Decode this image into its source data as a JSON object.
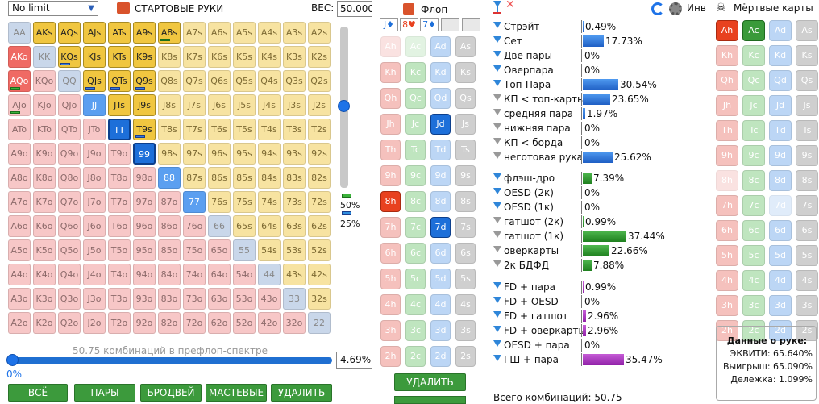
{
  "top": {
    "limit": "No limit",
    "hands_title": "СТАРТОВЫЕ РУКИ",
    "wes_label": "ВЕС:",
    "wes_value": "50.000"
  },
  "matrix": [
    [
      [
        "AA",
        "pp"
      ],
      [
        "AKs",
        "sel-y"
      ],
      [
        "AQs",
        "sel-y"
      ],
      [
        "AJs",
        "sel-y"
      ],
      [
        "ATs",
        "sel-y"
      ],
      [
        "A9s",
        "sel-y"
      ],
      [
        "A8s",
        "sel-y"
      ],
      [
        "A7s",
        "so"
      ],
      [
        "A6s",
        "so"
      ],
      [
        "A5s",
        "so"
      ],
      [
        "A4s",
        "so"
      ],
      [
        "A3s",
        "so"
      ],
      [
        "A2s",
        "so"
      ]
    ],
    [
      [
        "AKo",
        "sel-r"
      ],
      [
        "KK",
        "pp"
      ],
      [
        "KQs",
        "sel-y"
      ],
      [
        "KJs",
        "sel-y"
      ],
      [
        "KTs",
        "sel-y"
      ],
      [
        "K9s",
        "sel-y"
      ],
      [
        "K8s",
        "so"
      ],
      [
        "K7s",
        "so"
      ],
      [
        "K6s",
        "so"
      ],
      [
        "K5s",
        "so"
      ],
      [
        "K4s",
        "so"
      ],
      [
        "K3s",
        "so"
      ],
      [
        "K2s",
        "so"
      ]
    ],
    [
      [
        "AQo",
        "sel-r"
      ],
      [
        "KQo",
        "of"
      ],
      [
        "QQ",
        "pp"
      ],
      [
        "QJs",
        "sel-y"
      ],
      [
        "QTs",
        "sel-y"
      ],
      [
        "Q9s",
        "sel-y"
      ],
      [
        "Q8s",
        "so"
      ],
      [
        "Q7s",
        "so"
      ],
      [
        "Q6s",
        "so"
      ],
      [
        "Q5s",
        "so"
      ],
      [
        "Q4s",
        "so"
      ],
      [
        "Q3s",
        "so"
      ],
      [
        "Q2s",
        "so"
      ]
    ],
    [
      [
        "AJo",
        "of"
      ],
      [
        "KJo",
        "of"
      ],
      [
        "QJo",
        "of"
      ],
      [
        "JJ",
        "sel-b"
      ],
      [
        "JTs",
        "sel-y"
      ],
      [
        "J9s",
        "sel-y"
      ],
      [
        "J8s",
        "so"
      ],
      [
        "J7s",
        "so"
      ],
      [
        "J6s",
        "so"
      ],
      [
        "J5s",
        "so"
      ],
      [
        "J4s",
        "so"
      ],
      [
        "J3s",
        "so"
      ],
      [
        "J2s",
        "so"
      ]
    ],
    [
      [
        "ATo",
        "of"
      ],
      [
        "KTo",
        "of"
      ],
      [
        "QTo",
        "of"
      ],
      [
        "JTo",
        "of"
      ],
      [
        "TT",
        "sel-db"
      ],
      [
        "T9s",
        "sel-y"
      ],
      [
        "T8s",
        "so"
      ],
      [
        "T7s",
        "so"
      ],
      [
        "T6s",
        "so"
      ],
      [
        "T5s",
        "so"
      ],
      [
        "T4s",
        "so"
      ],
      [
        "T3s",
        "so"
      ],
      [
        "T2s",
        "so"
      ]
    ],
    [
      [
        "A9o",
        "of"
      ],
      [
        "K9o",
        "of"
      ],
      [
        "Q9o",
        "of"
      ],
      [
        "J9o",
        "of"
      ],
      [
        "T9o",
        "of"
      ],
      [
        "99",
        "sel-db"
      ],
      [
        "98s",
        "so"
      ],
      [
        "97s",
        "so"
      ],
      [
        "96s",
        "so"
      ],
      [
        "95s",
        "so"
      ],
      [
        "94s",
        "so"
      ],
      [
        "93s",
        "so"
      ],
      [
        "92s",
        "so"
      ]
    ],
    [
      [
        "A8o",
        "of"
      ],
      [
        "K8o",
        "of"
      ],
      [
        "Q8o",
        "of"
      ],
      [
        "J8o",
        "of"
      ],
      [
        "T8o",
        "of"
      ],
      [
        "98o",
        "of"
      ],
      [
        "88",
        "sel-b"
      ],
      [
        "87s",
        "so"
      ],
      [
        "86s",
        "so"
      ],
      [
        "85s",
        "so"
      ],
      [
        "84s",
        "so"
      ],
      [
        "83s",
        "so"
      ],
      [
        "82s",
        "so"
      ]
    ],
    [
      [
        "A7o",
        "of"
      ],
      [
        "K7o",
        "of"
      ],
      [
        "Q7o",
        "of"
      ],
      [
        "J7o",
        "of"
      ],
      [
        "T7o",
        "of"
      ],
      [
        "97o",
        "of"
      ],
      [
        "87o",
        "of"
      ],
      [
        "77",
        "sel-b"
      ],
      [
        "76s",
        "so"
      ],
      [
        "75s",
        "so"
      ],
      [
        "74s",
        "so"
      ],
      [
        "73s",
        "so"
      ],
      [
        "72s",
        "so"
      ]
    ],
    [
      [
        "A6o",
        "of"
      ],
      [
        "K6o",
        "of"
      ],
      [
        "Q6o",
        "of"
      ],
      [
        "J6o",
        "of"
      ],
      [
        "T6o",
        "of"
      ],
      [
        "96o",
        "of"
      ],
      [
        "86o",
        "of"
      ],
      [
        "76o",
        "of"
      ],
      [
        "66",
        "pp"
      ],
      [
        "65s",
        "so"
      ],
      [
        "64s",
        "so"
      ],
      [
        "63s",
        "so"
      ],
      [
        "62s",
        "so"
      ]
    ],
    [
      [
        "A5o",
        "of"
      ],
      [
        "K5o",
        "of"
      ],
      [
        "Q5o",
        "of"
      ],
      [
        "J5o",
        "of"
      ],
      [
        "T5o",
        "of"
      ],
      [
        "95o",
        "of"
      ],
      [
        "85o",
        "of"
      ],
      [
        "75o",
        "of"
      ],
      [
        "65o",
        "of"
      ],
      [
        "55",
        "pp"
      ],
      [
        "54s",
        "so"
      ],
      [
        "53s",
        "so"
      ],
      [
        "52s",
        "so"
      ]
    ],
    [
      [
        "A4o",
        "of"
      ],
      [
        "K4o",
        "of"
      ],
      [
        "Q4o",
        "of"
      ],
      [
        "J4o",
        "of"
      ],
      [
        "T4o",
        "of"
      ],
      [
        "94o",
        "of"
      ],
      [
        "84o",
        "of"
      ],
      [
        "74o",
        "of"
      ],
      [
        "64o",
        "of"
      ],
      [
        "54o",
        "of"
      ],
      [
        "44",
        "pp"
      ],
      [
        "43s",
        "so"
      ],
      [
        "42s",
        "so"
      ]
    ],
    [
      [
        "A3o",
        "of"
      ],
      [
        "K3o",
        "of"
      ],
      [
        "Q3o",
        "of"
      ],
      [
        "J3o",
        "of"
      ],
      [
        "T3o",
        "of"
      ],
      [
        "93o",
        "of"
      ],
      [
        "83o",
        "of"
      ],
      [
        "73o",
        "of"
      ],
      [
        "63o",
        "of"
      ],
      [
        "53o",
        "of"
      ],
      [
        "43o",
        "of"
      ],
      [
        "33",
        "pp"
      ],
      [
        "32s",
        "so"
      ]
    ],
    [
      [
        "A2o",
        "of"
      ],
      [
        "K2o",
        "of"
      ],
      [
        "Q2o",
        "of"
      ],
      [
        "J2o",
        "of"
      ],
      [
        "T2o",
        "of"
      ],
      [
        "92o",
        "of"
      ],
      [
        "82o",
        "of"
      ],
      [
        "72o",
        "of"
      ],
      [
        "62o",
        "of"
      ],
      [
        "52o",
        "of"
      ],
      [
        "42o",
        "of"
      ],
      [
        "32o",
        "of"
      ],
      [
        "22",
        "pp"
      ]
    ]
  ],
  "slider": {
    "pct50": "50%",
    "pct25": "25%",
    "weight_level": 0.5
  },
  "range": {
    "combos_text": "50.75 комбинаций в префлоп-спектре",
    "zero": "0%",
    "pct": "4.69%",
    "fill_fraction": 0.0469
  },
  "buttons": {
    "all": "ВСЁ",
    "pairs": "ПАРЫ",
    "broadway": "БРОДВЕЙ",
    "suited": "МАСТЕВЫЕ",
    "delete": "УДАЛИТЬ"
  },
  "flop": {
    "title": "Флоп",
    "slots": [
      "J♦",
      "8♥",
      "7♦",
      "",
      ""
    ],
    "delete": "УДАЛИТЬ",
    "cards": [
      [
        [
          "Ah",
          "h dim"
        ],
        [
          "Ac",
          "c dim"
        ],
        [
          "Ad",
          "d"
        ],
        [
          "As",
          "s"
        ]
      ],
      [
        [
          "Kh",
          "h"
        ],
        [
          "Kc",
          "c"
        ],
        [
          "Kd",
          "d"
        ],
        [
          "Ks",
          "s"
        ]
      ],
      [
        [
          "Qh",
          "h"
        ],
        [
          "Qc",
          "c"
        ],
        [
          "Qd",
          "d"
        ],
        [
          "Qs",
          "s"
        ]
      ],
      [
        [
          "Jh",
          "h"
        ],
        [
          "Jc",
          "c"
        ],
        [
          "Jd",
          "ds"
        ],
        [
          "Js",
          "s"
        ]
      ],
      [
        [
          "Th",
          "h"
        ],
        [
          "Tc",
          "c"
        ],
        [
          "Td",
          "d"
        ],
        [
          "Ts",
          "s"
        ]
      ],
      [
        [
          "9h",
          "h"
        ],
        [
          "9c",
          "c"
        ],
        [
          "9d",
          "d"
        ],
        [
          "9s",
          "s"
        ]
      ],
      [
        [
          "8h",
          "hs"
        ],
        [
          "8c",
          "c"
        ],
        [
          "8d",
          "d"
        ],
        [
          "8s",
          "s"
        ]
      ],
      [
        [
          "7h",
          "h"
        ],
        [
          "7c",
          "c"
        ],
        [
          "7d",
          "ds"
        ],
        [
          "7s",
          "s"
        ]
      ],
      [
        [
          "6h",
          "h"
        ],
        [
          "6c",
          "c"
        ],
        [
          "6d",
          "d"
        ],
        [
          "6s",
          "s"
        ]
      ],
      [
        [
          "5h",
          "h"
        ],
        [
          "5c",
          "c"
        ],
        [
          "5d",
          "d"
        ],
        [
          "5s",
          "s"
        ]
      ],
      [
        [
          "4h",
          "h"
        ],
        [
          "4c",
          "c"
        ],
        [
          "4d",
          "d"
        ],
        [
          "4s",
          "s"
        ]
      ],
      [
        [
          "3h",
          "h"
        ],
        [
          "3c",
          "c"
        ],
        [
          "3d",
          "d"
        ],
        [
          "3s",
          "s"
        ]
      ],
      [
        [
          "2h",
          "h"
        ],
        [
          "2c",
          "c"
        ],
        [
          "2d",
          "d"
        ],
        [
          "2s",
          "s"
        ]
      ]
    ]
  },
  "stats": {
    "rows": [
      {
        "label": "Стрэйт",
        "value": "0.49%",
        "pct": 0.49,
        "color": "bb",
        "filter": "b"
      },
      {
        "label": "Сет",
        "value": "17.73%",
        "pct": 17.73,
        "color": "bb",
        "filter": "b"
      },
      {
        "label": "Две пары",
        "value": "0%",
        "pct": 0,
        "color": "bb",
        "filter": "b"
      },
      {
        "label": "Оверпара",
        "value": "0%",
        "pct": 0,
        "color": "bb",
        "filter": "b"
      },
      {
        "label": "Топ-Пара",
        "value": "30.54%",
        "pct": 30.54,
        "color": "bb",
        "filter": "b"
      },
      {
        "label": "КП < топ-карты",
        "value": "23.65%",
        "pct": 23.65,
        "color": "bb",
        "filter": "g"
      },
      {
        "label": "средняя пара",
        "value": "1.97%",
        "pct": 1.97,
        "color": "bb",
        "filter": "g"
      },
      {
        "label": "нижняя пара",
        "value": "0%",
        "pct": 0,
        "color": "bb",
        "filter": "g"
      },
      {
        "label": "КП < борда",
        "value": "0%",
        "pct": 0,
        "color": "bb",
        "filter": "g"
      },
      {
        "label": "неготовая рука",
        "value": "25.62%",
        "pct": 25.62,
        "color": "bb",
        "filter": "g"
      },
      {
        "label": "флэш-дро",
        "value": "7.39%",
        "pct": 7.39,
        "color": "gb",
        "filter": "b"
      },
      {
        "label": "OESD (2к)",
        "value": "0%",
        "pct": 0,
        "color": "gb",
        "filter": "b"
      },
      {
        "label": "OESD (1к)",
        "value": "0%",
        "pct": 0,
        "color": "gb",
        "filter": "b"
      },
      {
        "label": "гатшот (2к)",
        "value": "0.99%",
        "pct": 0.99,
        "color": "gb",
        "filter": "g"
      },
      {
        "label": "гатшот (1к)",
        "value": "37.44%",
        "pct": 37.44,
        "color": "gb",
        "filter": "g"
      },
      {
        "label": "оверкарты",
        "value": "22.66%",
        "pct": 22.66,
        "color": "gb",
        "filter": "g"
      },
      {
        "label": "2к БДФД",
        "value": "7.88%",
        "pct": 7.88,
        "color": "gb",
        "filter": "g"
      },
      {
        "label": "FD + пара",
        "value": "0.99%",
        "pct": 0.99,
        "color": "pb",
        "filter": "b"
      },
      {
        "label": "FD + OESD",
        "value": "0%",
        "pct": 0,
        "color": "pb",
        "filter": "b"
      },
      {
        "label": "FD + гатшот",
        "value": "2.96%",
        "pct": 2.96,
        "color": "pb",
        "filter": "b"
      },
      {
        "label": "FD + оверкарты",
        "value": "2.96%",
        "pct": 2.96,
        "color": "pb",
        "filter": "b"
      },
      {
        "label": "OESD + пара",
        "value": "0%",
        "pct": 0,
        "color": "pb",
        "filter": "b"
      },
      {
        "label": "ГШ + пара",
        "value": "35.47%",
        "pct": 35.47,
        "color": "pb",
        "filter": "b"
      }
    ],
    "total": "Всего комбинаций: 50.75"
  },
  "right": {
    "inv": "Инв",
    "dead_title": "Мёртвые карты"
  },
  "dead": [
    [
      [
        "Ah",
        "hs"
      ],
      [
        "Ac",
        "cs"
      ],
      [
        "Ad",
        "d"
      ],
      [
        "As",
        "s"
      ]
    ],
    [
      [
        "Kh",
        "h"
      ],
      [
        "Kc",
        "c"
      ],
      [
        "Kd",
        "d"
      ],
      [
        "Ks",
        "s"
      ]
    ],
    [
      [
        "Qh",
        "h"
      ],
      [
        "Qc",
        "c"
      ],
      [
        "Qd",
        "d"
      ],
      [
        "Qs",
        "s"
      ]
    ],
    [
      [
        "Jh",
        "h"
      ],
      [
        "Jc",
        "c"
      ],
      [
        "Jd",
        "d"
      ],
      [
        "Js",
        "s"
      ]
    ],
    [
      [
        "Th",
        "h"
      ],
      [
        "Tc",
        "c"
      ],
      [
        "Td",
        "d"
      ],
      [
        "Ts",
        "s"
      ]
    ],
    [
      [
        "9h",
        "h"
      ],
      [
        "9c",
        "c"
      ],
      [
        "9d",
        "d"
      ],
      [
        "9s",
        "s"
      ]
    ],
    [
      [
        "8h",
        "h dim"
      ],
      [
        "8c",
        "c"
      ],
      [
        "8d",
        "d"
      ],
      [
        "8s",
        "s"
      ]
    ],
    [
      [
        "7h",
        "h"
      ],
      [
        "7c",
        "c"
      ],
      [
        "7d",
        "d dim"
      ],
      [
        "7s",
        "s"
      ]
    ],
    [
      [
        "6h",
        "h"
      ],
      [
        "6c",
        "c"
      ],
      [
        "6d",
        "d"
      ],
      [
        "6s",
        "s"
      ]
    ],
    [
      [
        "5h",
        "h"
      ],
      [
        "5c",
        "c"
      ],
      [
        "5d",
        "d"
      ],
      [
        "5s",
        "s"
      ]
    ],
    [
      [
        "4h",
        "h"
      ],
      [
        "4c",
        "c"
      ],
      [
        "4d",
        "d"
      ],
      [
        "4s",
        "s"
      ]
    ],
    [
      [
        "3h",
        "h"
      ],
      [
        "3c",
        "c"
      ],
      [
        "3d",
        "d"
      ],
      [
        "3s",
        "s"
      ]
    ],
    [
      [
        "2h",
        "h"
      ],
      [
        "2c",
        "c"
      ],
      [
        "2d",
        "d"
      ],
      [
        "2s",
        "s"
      ]
    ]
  ],
  "info": {
    "title": "Данные о руке:",
    "equity": "ЭКВИТИ: 65.640%",
    "win": "Выигрыш: 65.090%",
    "split": "Дележка: 1.099%"
  }
}
